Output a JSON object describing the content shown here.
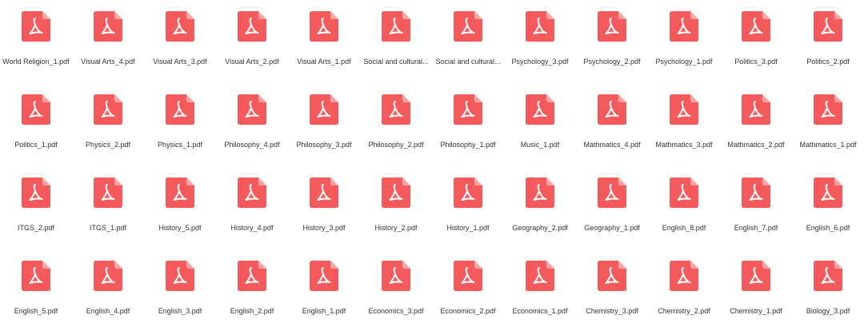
{
  "colors": {
    "icon_red": "#F4595B",
    "icon_fold": "#F9A3A4",
    "label": "#333333",
    "background": "#FFFFFF"
  },
  "icon_name": "pdf-file-icon",
  "files": [
    {
      "name": "World Religion_1.pdf"
    },
    {
      "name": "Visual Arts_4.pdf"
    },
    {
      "name": "Visual Arts_3.pdf"
    },
    {
      "name": "Visual Arts_2.pdf"
    },
    {
      "name": "Visual Arts_1.pdf"
    },
    {
      "name": "Social and cultural..."
    },
    {
      "name": "Social and cultural..."
    },
    {
      "name": "Psychology_3.pdf"
    },
    {
      "name": "Psychology_2.pdf"
    },
    {
      "name": "Psychology_1.pdf"
    },
    {
      "name": "Politics_3.pdf"
    },
    {
      "name": "Politics_2.pdf"
    },
    {
      "name": "Politics_1.pdf"
    },
    {
      "name": "Physics_2.pdf"
    },
    {
      "name": "Physics_1.pdf"
    },
    {
      "name": "Philosophy_4.pdf"
    },
    {
      "name": "Philosophy_3.pdf"
    },
    {
      "name": "Philosophy_2.pdf"
    },
    {
      "name": "Philosophy_1.pdf"
    },
    {
      "name": "Music_1.pdf"
    },
    {
      "name": "Mathmatics_4.pdf"
    },
    {
      "name": "Mathmatics_3.pdf"
    },
    {
      "name": "Mathmatics_2.pdf"
    },
    {
      "name": "Mathmatics_1.pdf"
    },
    {
      "name": "ITGS_2.pdf"
    },
    {
      "name": "ITGS_1.pdf"
    },
    {
      "name": "History_5.pdf"
    },
    {
      "name": "History_4.pdf"
    },
    {
      "name": "History_3.pdf"
    },
    {
      "name": "History_2.pdf"
    },
    {
      "name": "History_1.pdf"
    },
    {
      "name": "Geography_2.pdf"
    },
    {
      "name": "Geography_1.pdf"
    },
    {
      "name": "English_8.pdf"
    },
    {
      "name": "English_7.pdf"
    },
    {
      "name": "English_6.pdf"
    },
    {
      "name": "English_5.pdf"
    },
    {
      "name": "English_4.pdf"
    },
    {
      "name": "English_3.pdf"
    },
    {
      "name": "English_2.pdf"
    },
    {
      "name": "English_1.pdf"
    },
    {
      "name": "Economics_3.pdf"
    },
    {
      "name": "Economics_2.pdf"
    },
    {
      "name": "Economics_1.pdf"
    },
    {
      "name": "Chemistry_3.pdf"
    },
    {
      "name": "Chemistry_2.pdf"
    },
    {
      "name": "Chemistry_1.pdf"
    },
    {
      "name": "Biology_3.pdf"
    }
  ]
}
